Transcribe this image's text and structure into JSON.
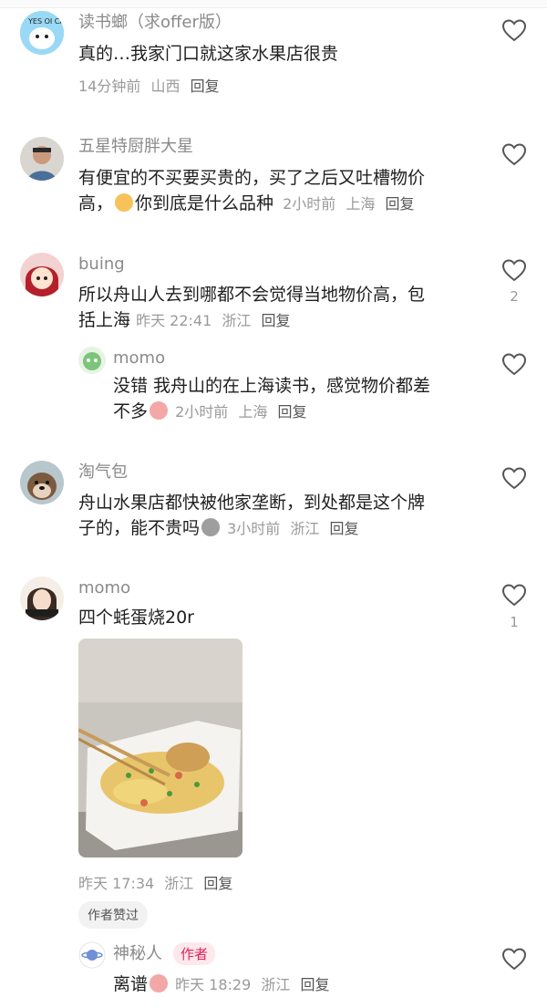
{
  "comments": [
    {
      "name": "读书螂（求offer版）",
      "text": "真的…我家门口就这家水果店很贵",
      "time": "14分钟前",
      "location": "山西",
      "reply": "回复",
      "avatar_text": "YES OI CAN"
    },
    {
      "name": "五星特厨胖大星",
      "text_line1": "有便宜的不买要买贵的，买了之后又吐槽物价",
      "text_line2": "高，",
      "text_line2b": "你到底是什么品种",
      "time": "2小时前",
      "location": "上海",
      "reply": "回复"
    },
    {
      "name": "buing",
      "text_line1": "所以舟山人去到哪都不会觉得当地物价高，包",
      "text_line2": "括上海",
      "time": "昨天 22:41",
      "location": "浙江",
      "reply": "回复",
      "likes": "2",
      "sub": {
        "name": "momo",
        "text_line1": "没错 我舟山的在上海读书，感觉物价都差",
        "text_line2": "不多",
        "time": "2小时前",
        "location": "上海",
        "reply": "回复"
      }
    },
    {
      "name": "淘气包",
      "text_line1": "舟山水果店都快被他家垄断，到处都是这个牌",
      "text_line2": "子的，能不贵吗",
      "time": "3小时前",
      "location": "浙江",
      "reply": "回复"
    },
    {
      "name": "momo",
      "text": "四个蚝蛋烧20r",
      "time": "昨天 17:34",
      "location": "浙江",
      "reply": "回复",
      "likes": "1",
      "liked_badge": "作者赞过",
      "sub": {
        "name": "神秘人",
        "author_badge": "作者",
        "text": "离谱",
        "time": "昨天 18:29",
        "location": "浙江",
        "reply": "回复"
      }
    }
  ],
  "colors": {
    "accent": "#e0245e",
    "meta": "#9a9a9a"
  }
}
